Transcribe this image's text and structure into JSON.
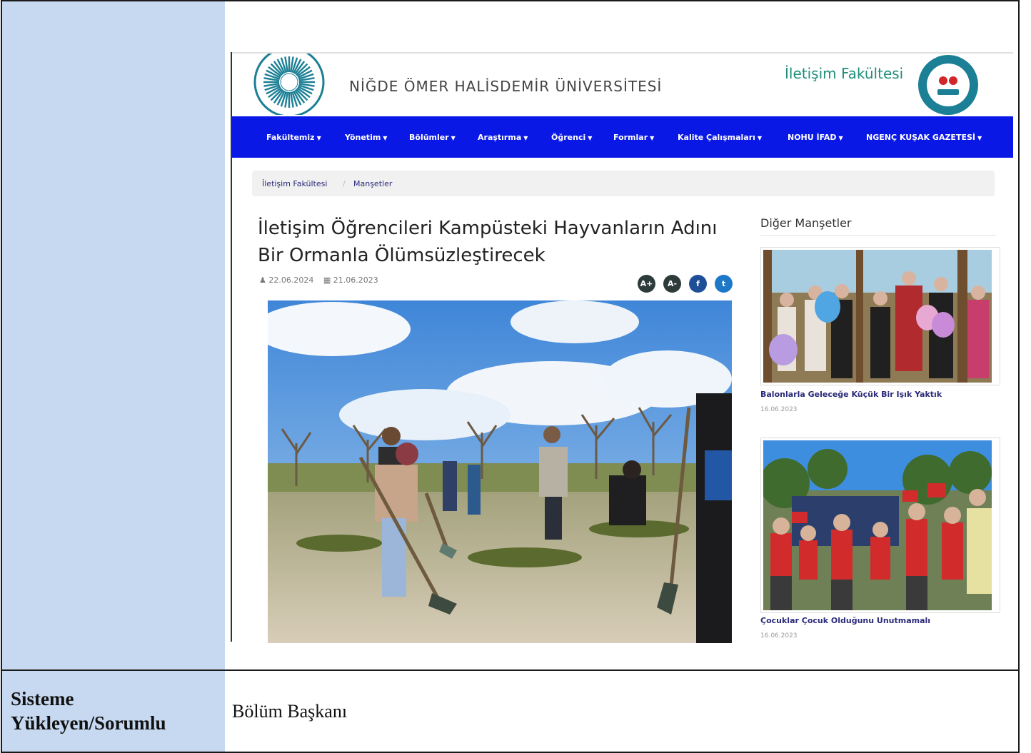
{
  "table": {
    "bottom_label": "Sisteme Yükleyen/Sorumlu",
    "bottom_value": "Bölüm Başkanı"
  },
  "website": {
    "university_name": "NİĞDE ÖMER HALİSDEMİR ÜNİVERSİTESİ",
    "faculty_name": "İletişim Fakültesi",
    "nav": [
      "Fakültemiz",
      "Yönetim",
      "Bölümler",
      "Araştırma",
      "Öğrenci",
      "Formlar",
      "Kalite Çalışmaları",
      "NOHU İFAD",
      "NGENÇ KUŞAK GAZETESİ"
    ],
    "breadcrumb": {
      "home": "İletişim Fakültesi",
      "separator": "/",
      "current": "Manşetler"
    },
    "article": {
      "title": "İletişim Öğrencileri Kampüsteki Hayvanların Adını Bir Ormanla Ölümsüzleştirecek",
      "author_date": "22.06.2024",
      "publish_date": "21.06.2023"
    },
    "share_buttons": [
      "A+",
      "A-",
      "f",
      "t"
    ],
    "sidebar": {
      "heading": "Diğer Manşetler",
      "items": [
        {
          "title": "Balonlarla Geleceğe Küçük Bir Işık Yaktık",
          "date": "16.06.2023"
        },
        {
          "title": "Çocuklar Çocuk Olduğunu Unutmamalı",
          "date": "16.06.2023"
        }
      ]
    }
  }
}
